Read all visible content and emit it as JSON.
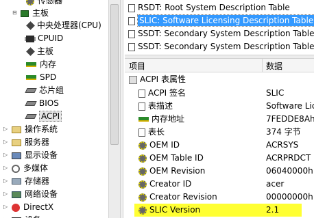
{
  "tree": {
    "partial_top": "传感器",
    "mainboard": "主板",
    "children": [
      {
        "label": "中央处理器(CPU)",
        "icon": "cpu-icon"
      },
      {
        "label": "CPUID",
        "icon": "cpuid-icon"
      },
      {
        "label": "主板",
        "icon": "motherboard-icon"
      },
      {
        "label": "内存",
        "icon": "memory-icon"
      },
      {
        "label": "SPD",
        "icon": "spd-icon"
      },
      {
        "label": "芯片组",
        "icon": "chipset-icon"
      },
      {
        "label": "BIOS",
        "icon": "bios-icon"
      },
      {
        "label": "ACPI",
        "icon": "acpi-icon"
      }
    ],
    "categories": [
      {
        "label": "操作系统",
        "icon": "os-icon"
      },
      {
        "label": "服务器",
        "icon": "server-icon"
      },
      {
        "label": "显示设备",
        "icon": "display-icon"
      },
      {
        "label": "多媒体",
        "icon": "multimedia-icon"
      },
      {
        "label": "存储器",
        "icon": "storage-icon"
      },
      {
        "label": "网络设备",
        "icon": "network-icon"
      },
      {
        "label": "DirectX",
        "icon": "directx-icon"
      },
      {
        "label": "设备",
        "icon": "devices-icon"
      }
    ]
  },
  "tables": [
    "RSDT: Root System Description Table",
    "SLIC: Software Licensing Description Table",
    "SSDT: Secondary System Description Table",
    "SSDT: Secondary System Description Table"
  ],
  "selected_table_index": 1,
  "columns": {
    "item": "项目",
    "data": "数据"
  },
  "group": "ACPI 表属性",
  "properties": [
    {
      "name": "ACPI 签名",
      "value": "SLIC",
      "icon": "doc-icon"
    },
    {
      "name": "表描述",
      "value": "Software Lice",
      "icon": "doc-icon"
    },
    {
      "name": "内存地址",
      "value": "7FEDDE8Ah",
      "icon": "memory-icon"
    },
    {
      "name": "表长",
      "value": "374 字节",
      "icon": "doc-icon"
    },
    {
      "name": "OEM ID",
      "value": "ACRSYS",
      "icon": "gear-icon"
    },
    {
      "name": "OEM Table ID",
      "value": "ACRPRDCT",
      "icon": "gear-icon"
    },
    {
      "name": "OEM Revision",
      "value": "06040000h",
      "icon": "gear-icon"
    },
    {
      "name": "Creator ID",
      "value": "acer",
      "icon": "gear-icon"
    },
    {
      "name": "Creator Revision",
      "value": "00000000h",
      "icon": "gear-icon"
    },
    {
      "name": "SLIC Version",
      "value": "2.1",
      "icon": "gear-icon",
      "highlighted": true
    }
  ],
  "colors": {
    "highlight": "#ffff33",
    "selection": "#3399ff"
  }
}
